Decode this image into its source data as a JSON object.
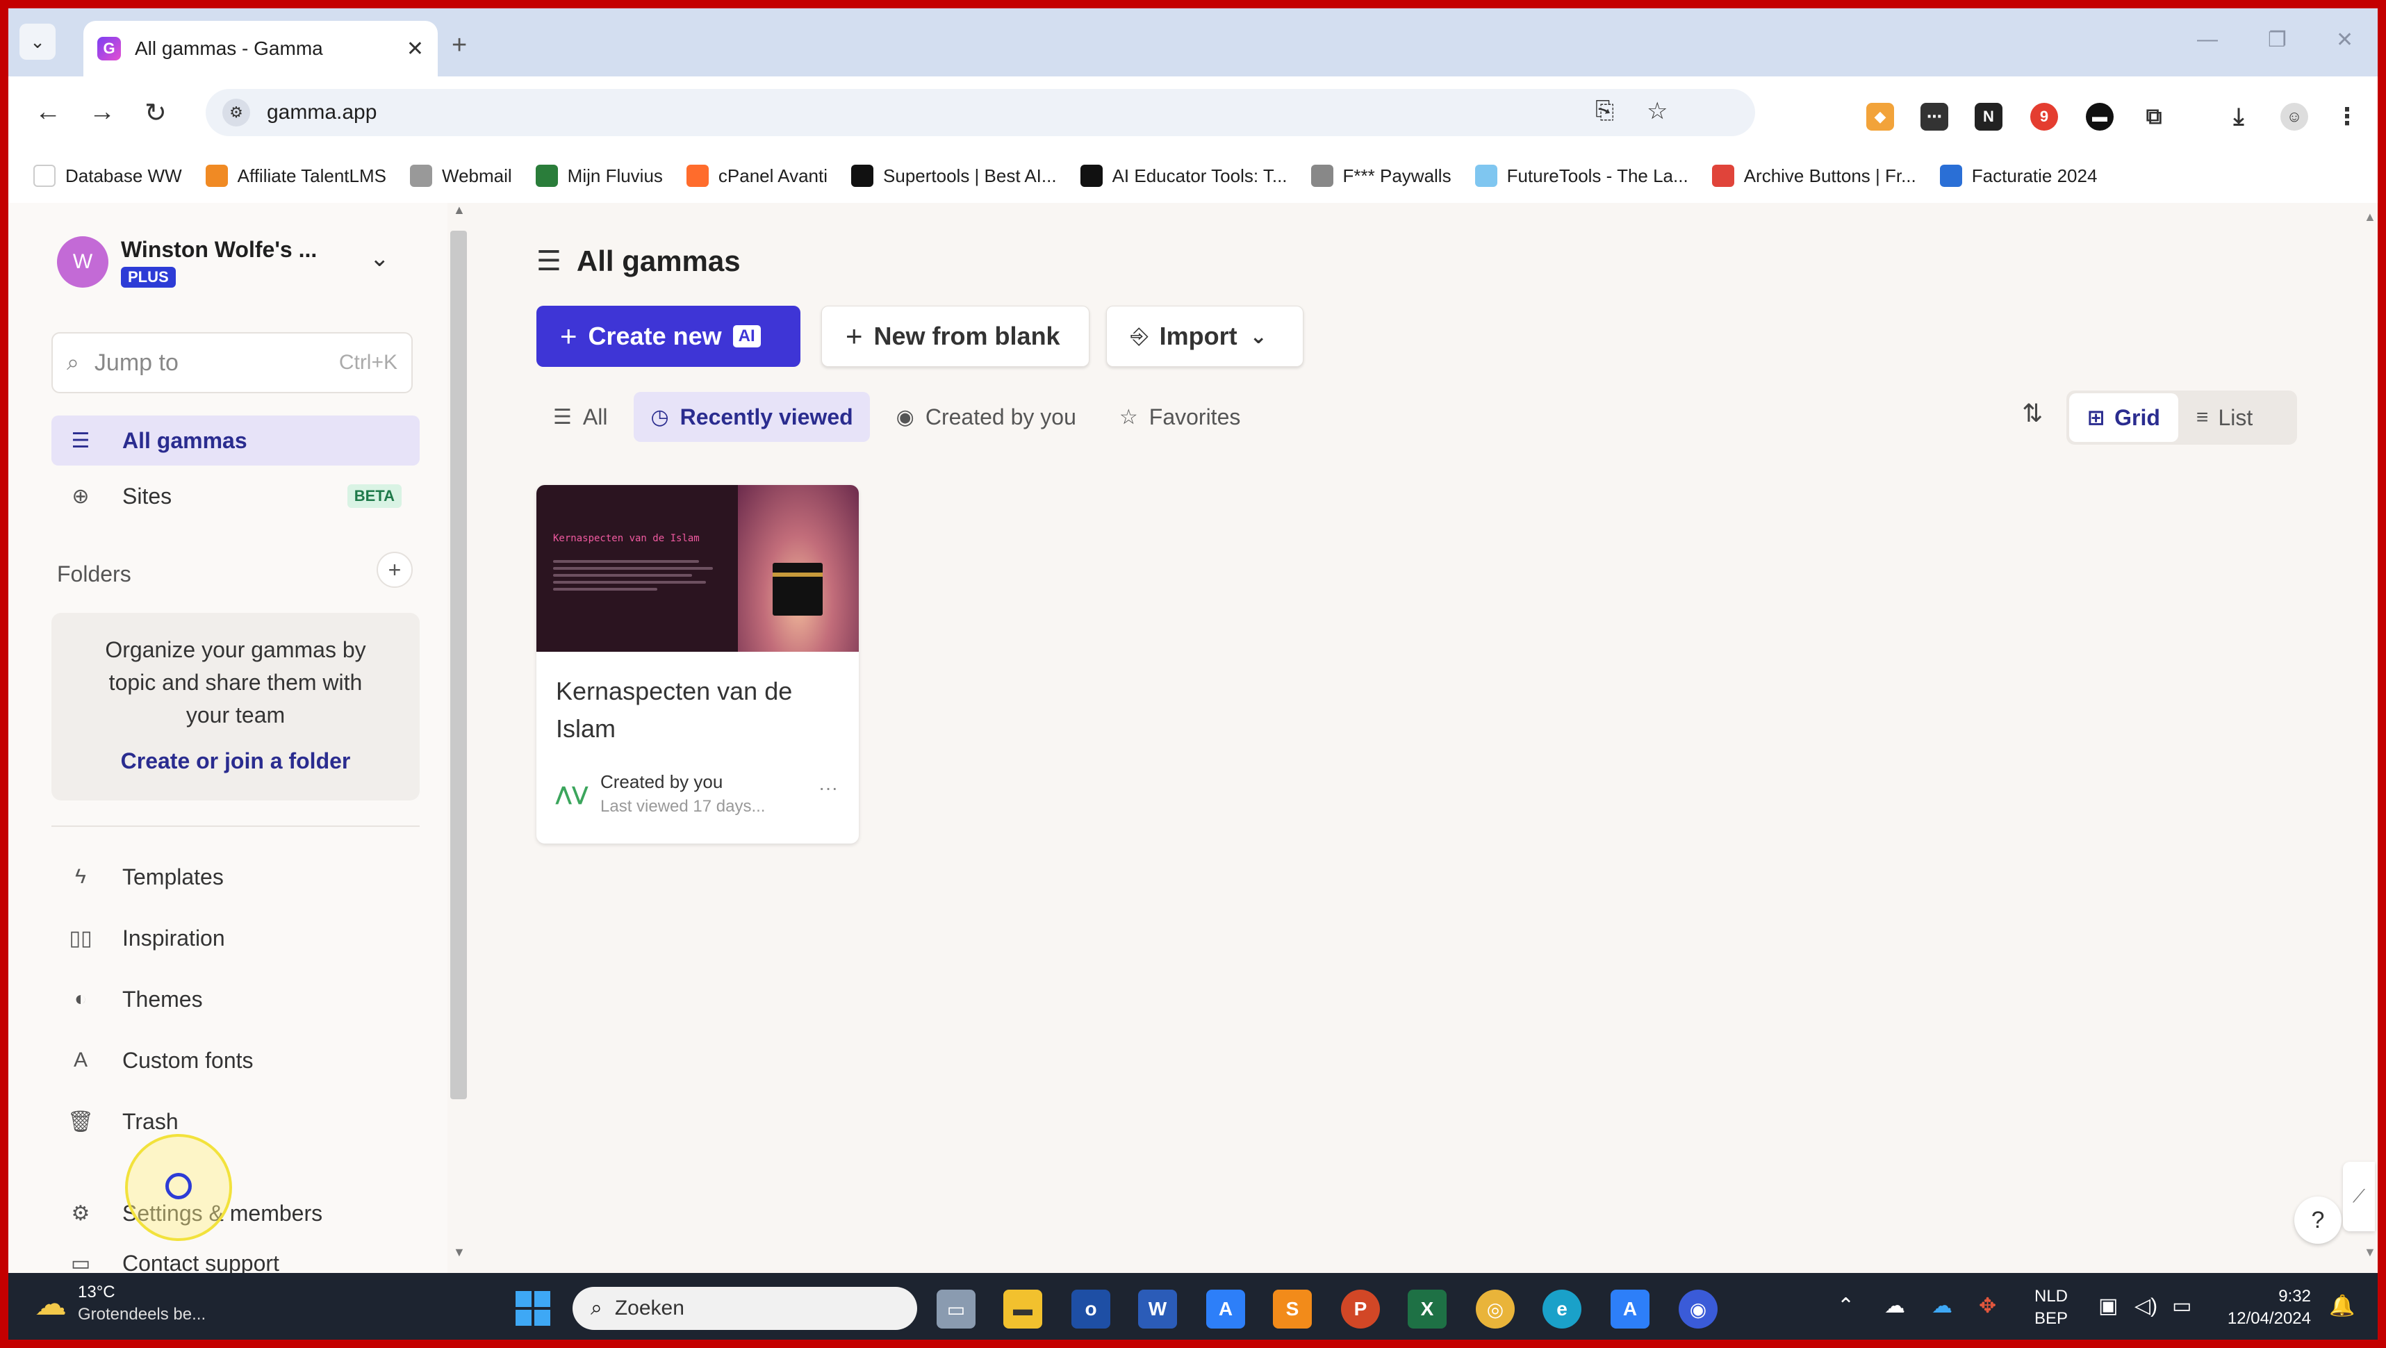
{
  "browser": {
    "tab_title": "All gammas - Gamma",
    "url": "gamma.app",
    "bookmarks": [
      {
        "label": "Database WW",
        "icon": "page-icon",
        "color": "#ffffff"
      },
      {
        "label": "Affiliate TalentLMS",
        "icon": "talentlms-icon",
        "color": "#f08a24"
      },
      {
        "label": "Webmail",
        "icon": "dash-icon",
        "color": "#999999"
      },
      {
        "label": "Mijn Fluvius",
        "icon": "fluvius-icon",
        "color": "#2a7d3a"
      },
      {
        "label": "cPanel Avanti",
        "icon": "cpanel-icon",
        "color": "#ff6c2c"
      },
      {
        "label": "Supertools | Best AI...",
        "icon": "supertools-icon",
        "color": "#111111"
      },
      {
        "label": "AI Educator Tools: T...",
        "icon": "ai-educator-icon",
        "color": "#111111"
      },
      {
        "label": "F*** Paywalls",
        "icon": "paywall-icon",
        "color": "#888888"
      },
      {
        "label": "FutureTools - The La...",
        "icon": "futuretools-icon",
        "color": "#7fc6f0"
      },
      {
        "label": "Archive Buttons | Fr...",
        "icon": "archive-icon",
        "color": "#e0443a"
      },
      {
        "label": "Facturatie 2024",
        "icon": "facturatie-icon",
        "color": "#2a6fd6"
      }
    ]
  },
  "sidebar": {
    "workspace_name": "Winston Wolfe's ...",
    "workspace_initial": "W",
    "plan_badge": "PLUS",
    "jump_placeholder": "Jump to",
    "jump_shortcut": "Ctrl+K",
    "primary_items": [
      {
        "label": "All gammas",
        "icon": "gammas-stack-icon",
        "active": true
      },
      {
        "label": "Sites",
        "icon": "globe-icon",
        "badge": "BETA"
      }
    ],
    "folders_label": "Folders",
    "folder_empty_text": "Organize your gammas by topic and share them with your team",
    "folder_link": "Create or join a folder",
    "secondary_items": [
      {
        "label": "Templates",
        "icon": "lightning-icon"
      },
      {
        "label": "Inspiration",
        "icon": "book-icon"
      },
      {
        "label": "Themes",
        "icon": "palette-icon"
      },
      {
        "label": "Custom fonts",
        "icon": "font-icon"
      },
      {
        "label": "Trash",
        "icon": "trash-icon"
      },
      {
        "label": "Settings & members",
        "icon": "settings-icon"
      },
      {
        "label": "Contact support",
        "icon": "chat-icon"
      }
    ]
  },
  "main": {
    "title": "All gammas",
    "actions": {
      "create_new": "Create new",
      "ai_badge": "AI",
      "new_from_blank": "New from blank",
      "import": "Import"
    },
    "filters": [
      {
        "label": "All",
        "icon": "stack-icon"
      },
      {
        "label": "Recently viewed",
        "icon": "clock-icon",
        "active": true
      },
      {
        "label": "Created by you",
        "icon": "user-circle-icon"
      },
      {
        "label": "Favorites",
        "icon": "star-icon"
      }
    ],
    "views": {
      "grid": "Grid",
      "list": "List",
      "selected": "Grid"
    },
    "cards": [
      {
        "title": "Kernaspecten van de Islam",
        "thumb_title": "Kernaspecten van de Islam",
        "created_by": "Created by you",
        "last_viewed": "Last viewed 17 days...",
        "more": "···"
      }
    ],
    "help": "?"
  },
  "taskbar": {
    "temperature": "13°C",
    "weather": "Grotendeels be...",
    "search_placeholder": "Zoeken",
    "lang_top": "NLD",
    "lang_bottom": "BEP",
    "time": "9:32",
    "date": "12/04/2024"
  },
  "colors": {
    "accent": "#3e35d6",
    "active_bg": "#e7e3f8",
    "active_text": "#2a2c8f",
    "beta_bg": "#d9f3e4",
    "frame_border": "#c40000"
  }
}
